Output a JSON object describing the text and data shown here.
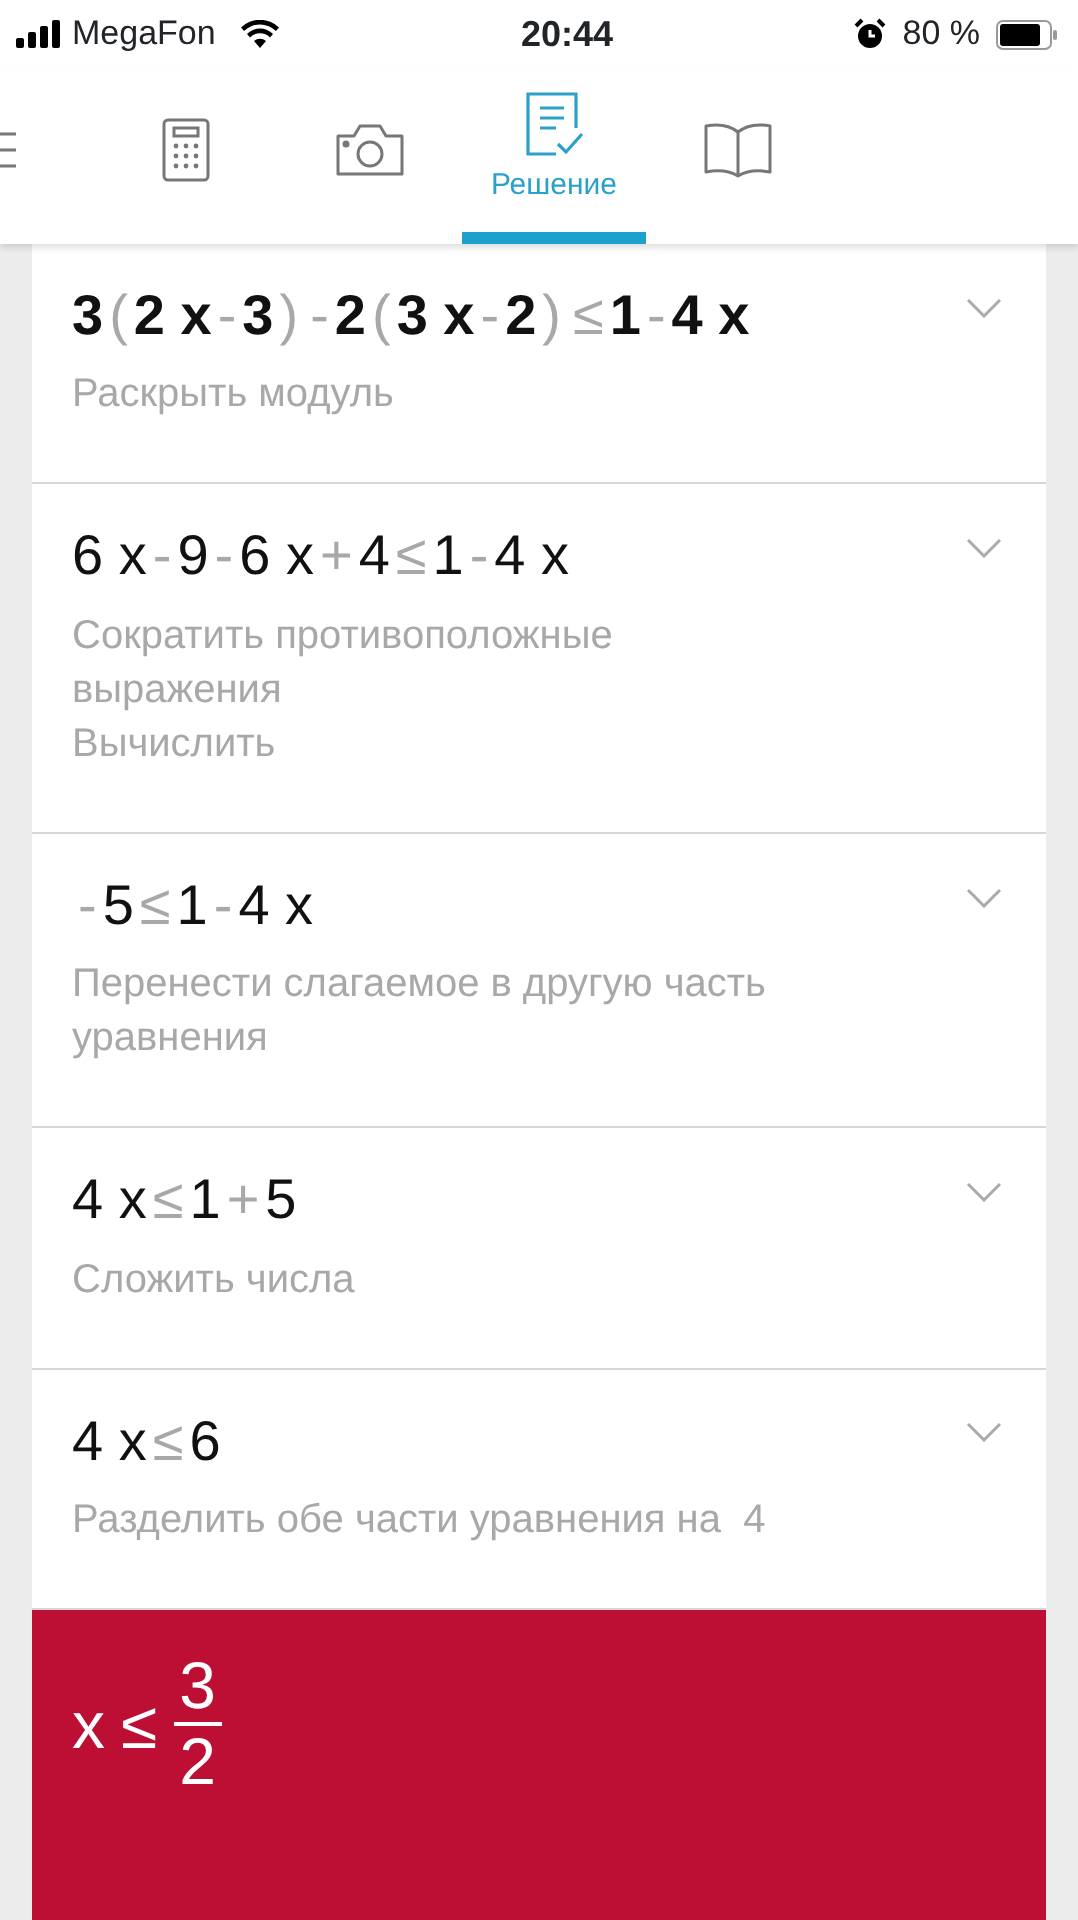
{
  "status_bar": {
    "carrier": "MegaFon",
    "time": "20:44",
    "battery": "80 %"
  },
  "tabs": [
    {
      "kind": "menu",
      "selected": false
    },
    {
      "kind": "calculator",
      "selected": false
    },
    {
      "kind": "camera",
      "selected": false
    },
    {
      "kind": "solution",
      "label": "Решение",
      "selected": true
    },
    {
      "kind": "book",
      "selected": false
    }
  ],
  "steps": [
    {
      "bold": true,
      "expanded": false,
      "expression": [
        {
          "t": "3",
          "kind": "term"
        },
        {
          "t": "(",
          "kind": "op"
        },
        {
          "t": "2 x",
          "kind": "term"
        },
        {
          "t": "-",
          "kind": "op"
        },
        {
          "t": "3",
          "kind": "term"
        },
        {
          "t": ")",
          "kind": "op"
        },
        {
          "t": "-",
          "kind": "op"
        },
        {
          "t": "2",
          "kind": "term"
        },
        {
          "t": "(",
          "kind": "op"
        },
        {
          "t": "3 x",
          "kind": "term"
        },
        {
          "t": "-",
          "kind": "op"
        },
        {
          "t": "2",
          "kind": "term"
        },
        {
          "t": ")",
          "kind": "op"
        },
        {
          "t": "≤",
          "kind": "op"
        },
        {
          "t": "1",
          "kind": "term"
        },
        {
          "t": "-",
          "kind": "op"
        },
        {
          "t": "4 x",
          "kind": "term"
        }
      ],
      "descriptions": [
        "Раскрыть модуль"
      ]
    },
    {
      "bold": false,
      "expanded": false,
      "expression": [
        {
          "t": "6 x",
          "kind": "term"
        },
        {
          "t": "-",
          "kind": "op"
        },
        {
          "t": "9",
          "kind": "term"
        },
        {
          "t": "-",
          "kind": "op"
        },
        {
          "t": "6 x",
          "kind": "term"
        },
        {
          "t": "+",
          "kind": "op"
        },
        {
          "t": "4",
          "kind": "term"
        },
        {
          "t": "≤",
          "kind": "op"
        },
        {
          "t": "1",
          "kind": "term"
        },
        {
          "t": "-",
          "kind": "op"
        },
        {
          "t": "4 x",
          "kind": "term"
        }
      ],
      "descriptions": [
        "Сократить противоположные выражения",
        "Вычислить"
      ]
    },
    {
      "bold": false,
      "expanded": false,
      "expression": [
        {
          "t": "-",
          "kind": "op"
        },
        {
          "t": "5",
          "kind": "term"
        },
        {
          "t": "≤",
          "kind": "op"
        },
        {
          "t": "1",
          "kind": "term"
        },
        {
          "t": "-",
          "kind": "op"
        },
        {
          "t": "4 x",
          "kind": "term"
        }
      ],
      "descriptions": [
        "Перенести слагаемое в другую часть уравнения"
      ]
    },
    {
      "bold": false,
      "expanded": false,
      "expression": [
        {
          "t": "4 x",
          "kind": "term"
        },
        {
          "t": "≤",
          "kind": "op"
        },
        {
          "t": "1",
          "kind": "term"
        },
        {
          "t": "+",
          "kind": "op"
        },
        {
          "t": "5",
          "kind": "term"
        }
      ],
      "descriptions": [
        "Сложить числа"
      ]
    },
    {
      "bold": false,
      "expanded": false,
      "expression": [
        {
          "t": "4 x",
          "kind": "term"
        },
        {
          "t": "≤",
          "kind": "op"
        },
        {
          "t": "6",
          "kind": "term"
        }
      ],
      "descriptions": [
        "Разделить обе части уравнения на  4"
      ]
    }
  ],
  "answer": {
    "lhs": "x",
    "relation": "≤",
    "numerator": "3",
    "denominator": "2"
  }
}
